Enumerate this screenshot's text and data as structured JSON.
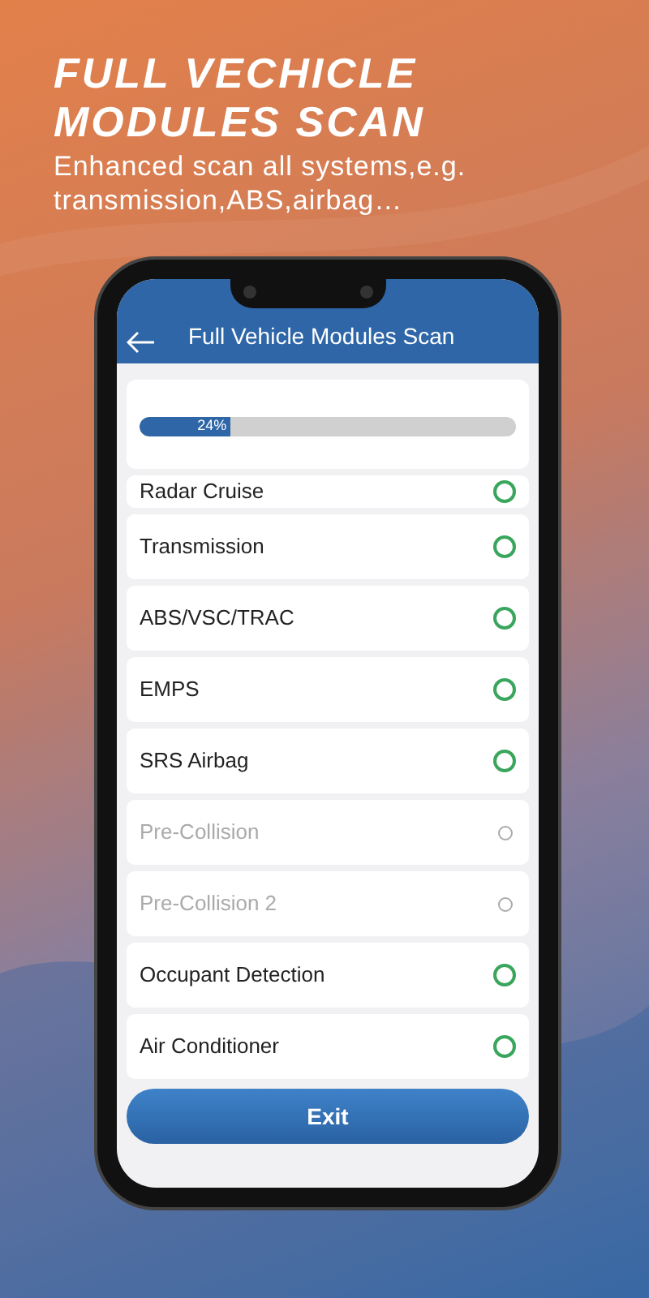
{
  "headline": {
    "title": "FULL VECHICLE MODULES SCAN",
    "subtitle": "Enhanced scan all systems,e.g. transmission,ABS,airbag…"
  },
  "screen": {
    "title": "Full Vehicle Modules Scan",
    "progress": {
      "level": 0.24,
      "reading": "24%"
    },
    "modules": [
      {
        "name": "Radar Cruise",
        "available": true
      },
      {
        "name": "Transmission",
        "available": true
      },
      {
        "name": "ABS/VSC/TRAC",
        "available": true
      },
      {
        "name": "EMPS",
        "available": true
      },
      {
        "name": "SRS Airbag",
        "available": true
      },
      {
        "name": "Pre-Collision",
        "available": false
      },
      {
        "name": "Pre-Collision 2",
        "available": false
      },
      {
        "name": "Occupant Detection",
        "available": true
      },
      {
        "name": "Air Conditioner",
        "available": true
      }
    ],
    "exit_button": "Exit"
  }
}
